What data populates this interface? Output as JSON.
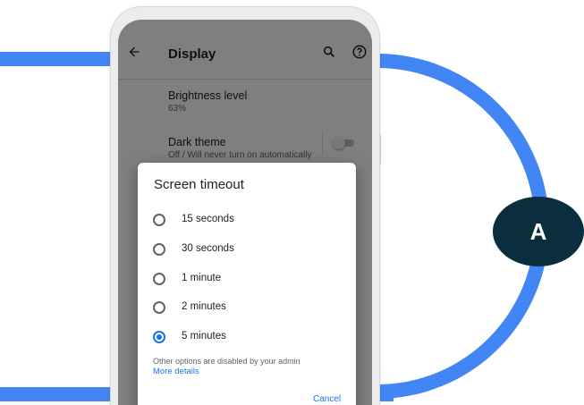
{
  "badge": {
    "letter": "A"
  },
  "appbar": {
    "title": "Display",
    "back_icon": "arrow-back-icon",
    "search_icon": "search-icon",
    "help_icon": "help-icon"
  },
  "settings": {
    "brightness": {
      "title": "Brightness level",
      "value": "63%"
    },
    "dark_theme": {
      "title": "Dark theme",
      "summary": "Off / Will never turn on automatically",
      "enabled": false
    }
  },
  "dialog": {
    "title": "Screen timeout",
    "options": [
      {
        "label": "15 seconds",
        "selected": false
      },
      {
        "label": "30 seconds",
        "selected": false
      },
      {
        "label": "1 minute",
        "selected": false
      },
      {
        "label": "2 minutes",
        "selected": false
      },
      {
        "label": "5 minutes",
        "selected": true
      }
    ],
    "admin_note": "Other options are disabled by your admin",
    "more_details": "More details",
    "cancel_label": "Cancel"
  },
  "colors": {
    "accent_blue": "#4285f4",
    "badge_bg": "#0b2e3f",
    "link_blue": "#1a73e8"
  }
}
